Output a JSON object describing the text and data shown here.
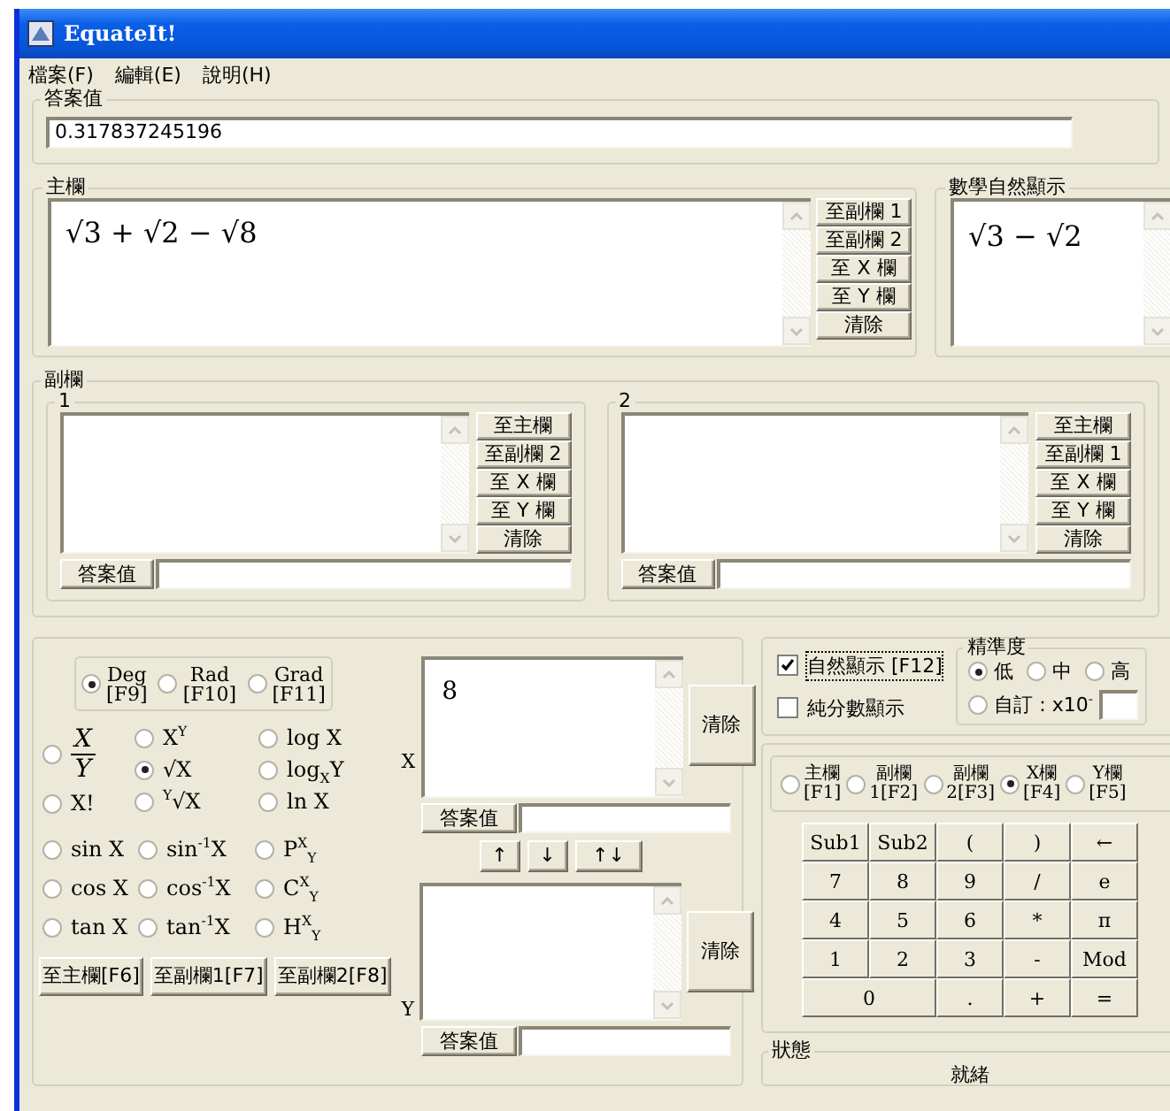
{
  "window": {
    "title": "EquateIt!"
  },
  "menu": [
    "檔案(F)",
    "編輯(E)",
    "說明(H)"
  ],
  "answer": {
    "label": "答案值",
    "value": "0.317837245196"
  },
  "main": {
    "label": "主欄",
    "expression": "√3 + √2 − √8",
    "buttons": [
      "至副欄 1",
      "至副欄 2",
      "至 X 欄",
      "至 Y 欄",
      "清除"
    ]
  },
  "natural_display": {
    "label": "數學自然顯示",
    "expression": "√3 − √2"
  },
  "sub": {
    "label": "副欄",
    "panels": [
      {
        "label": "1",
        "buttons": [
          "至主欄",
          "至副欄 2",
          "至 X 欄",
          "至 Y 欄",
          "清除"
        ],
        "answer_button": "答案值"
      },
      {
        "label": "2",
        "buttons": [
          "至主欄",
          "至副欄 1",
          "至 X 欄",
          "至 Y 欄",
          "清除"
        ],
        "answer_button": "答案值"
      }
    ]
  },
  "angle_modes": [
    {
      "lines": [
        "Deg",
        "[F9]"
      ],
      "selected": true
    },
    {
      "lines": [
        "Rad",
        "[F10]"
      ],
      "selected": false
    },
    {
      "lines": [
        "Grad",
        "[F11]"
      ],
      "selected": false
    }
  ],
  "function_columns": [
    [
      {
        "kind": "fraction",
        "numerator": "X",
        "denominator": "Y",
        "selected": false
      },
      {
        "kind": "text",
        "label": "X!",
        "selected": false
      }
    ],
    [
      {
        "kind": "text",
        "label": "X$^{Y}$",
        "selected": false
      },
      {
        "kind": "text",
        "label": "√X",
        "selected": true
      },
      {
        "kind": "text",
        "label": "$^{Y}$√X",
        "selected": false
      }
    ],
    [
      {
        "kind": "text",
        "label": "log X",
        "selected": false
      },
      {
        "kind": "text",
        "label": "log$_{X}$Y",
        "selected": false
      },
      {
        "kind": "text",
        "label": "ln X",
        "selected": false
      }
    ]
  ],
  "trig_rows": [
    [
      {
        "kind": "text",
        "label": "sin X",
        "selected": false
      },
      {
        "kind": "text",
        "label": "sin$^{-1}$X",
        "selected": false
      },
      {
        "kind": "text",
        "label": "P$^{X}$$_{Y}$",
        "selected": false
      }
    ],
    [
      {
        "kind": "text",
        "label": "cos X",
        "selected": false
      },
      {
        "kind": "text",
        "label": "cos$^{-1}$X",
        "selected": false
      },
      {
        "kind": "text",
        "label": "C$^{X}$$_{Y}$",
        "selected": false
      }
    ],
    [
      {
        "kind": "text",
        "label": "tan X",
        "selected": false
      },
      {
        "kind": "text",
        "label": "tan$^{-1}$X",
        "selected": false
      },
      {
        "kind": "text",
        "label": "H$^{X}$$_{Y}$",
        "selected": false
      }
    ]
  ],
  "transfer_buttons": [
    "至主欄[F6]",
    "至副欄1[F7]",
    "至副欄2[F8]"
  ],
  "x_field": {
    "label": "X",
    "value": "8",
    "clear": "清除",
    "answer_button": "答案值"
  },
  "swap_buttons": [
    "↑",
    "↓",
    "↑↓"
  ],
  "y_field": {
    "label": "Y",
    "clear": "清除",
    "answer_button": "答案值"
  },
  "display_options": [
    {
      "label": "自然顯示 [F12]",
      "checked": true,
      "focused": true
    },
    {
      "label": "純分數顯示",
      "checked": false,
      "focused": false
    }
  ],
  "precision": {
    "label": "精準度",
    "options": [
      {
        "label": "低",
        "selected": true
      },
      {
        "label": "中",
        "selected": false
      },
      {
        "label": "高",
        "selected": false
      }
    ],
    "custom": {
      "label": "自訂：x10$^{-}$",
      "selected": false
    }
  },
  "targets": [
    {
      "lines": [
        "主欄",
        "[F1]"
      ],
      "selected": false
    },
    {
      "lines": [
        "副欄",
        "1[F2]"
      ],
      "selected": false
    },
    {
      "lines": [
        "副欄",
        "2[F3]"
      ],
      "selected": false
    },
    {
      "lines": [
        "X欄",
        "[F4]"
      ],
      "selected": true
    },
    {
      "lines": [
        "Y欄",
        "[F5]"
      ],
      "selected": false
    }
  ],
  "keypad": [
    [
      {
        "kind": "key",
        "label": "Sub1"
      },
      {
        "kind": "key",
        "label": "Sub2"
      },
      {
        "kind": "key",
        "label": "("
      },
      {
        "kind": "key",
        "label": ")"
      },
      {
        "kind": "key",
        "label": "←"
      }
    ],
    [
      {
        "kind": "key",
        "label": "7"
      },
      {
        "kind": "key",
        "label": "8"
      },
      {
        "kind": "key",
        "label": "9"
      },
      {
        "kind": "key",
        "label": "/"
      },
      {
        "kind": "key",
        "label": "e"
      }
    ],
    [
      {
        "kind": "key",
        "label": "4"
      },
      {
        "kind": "key",
        "label": "5"
      },
      {
        "kind": "key",
        "label": "6"
      },
      {
        "kind": "key",
        "label": "*"
      },
      {
        "kind": "key",
        "label": "π"
      }
    ],
    [
      {
        "kind": "key",
        "label": "1"
      },
      {
        "kind": "key",
        "label": "2"
      },
      {
        "kind": "key",
        "label": "3"
      },
      {
        "kind": "key",
        "label": "-"
      },
      {
        "kind": "key",
        "label": "Mod"
      }
    ],
    [
      {
        "kind": "wide",
        "label": "0"
      },
      {
        "kind": "key",
        "label": "."
      },
      {
        "kind": "key",
        "label": "+"
      },
      {
        "kind": "key",
        "label": "="
      }
    ]
  ],
  "status": {
    "label": "狀態",
    "text": "就緒"
  }
}
